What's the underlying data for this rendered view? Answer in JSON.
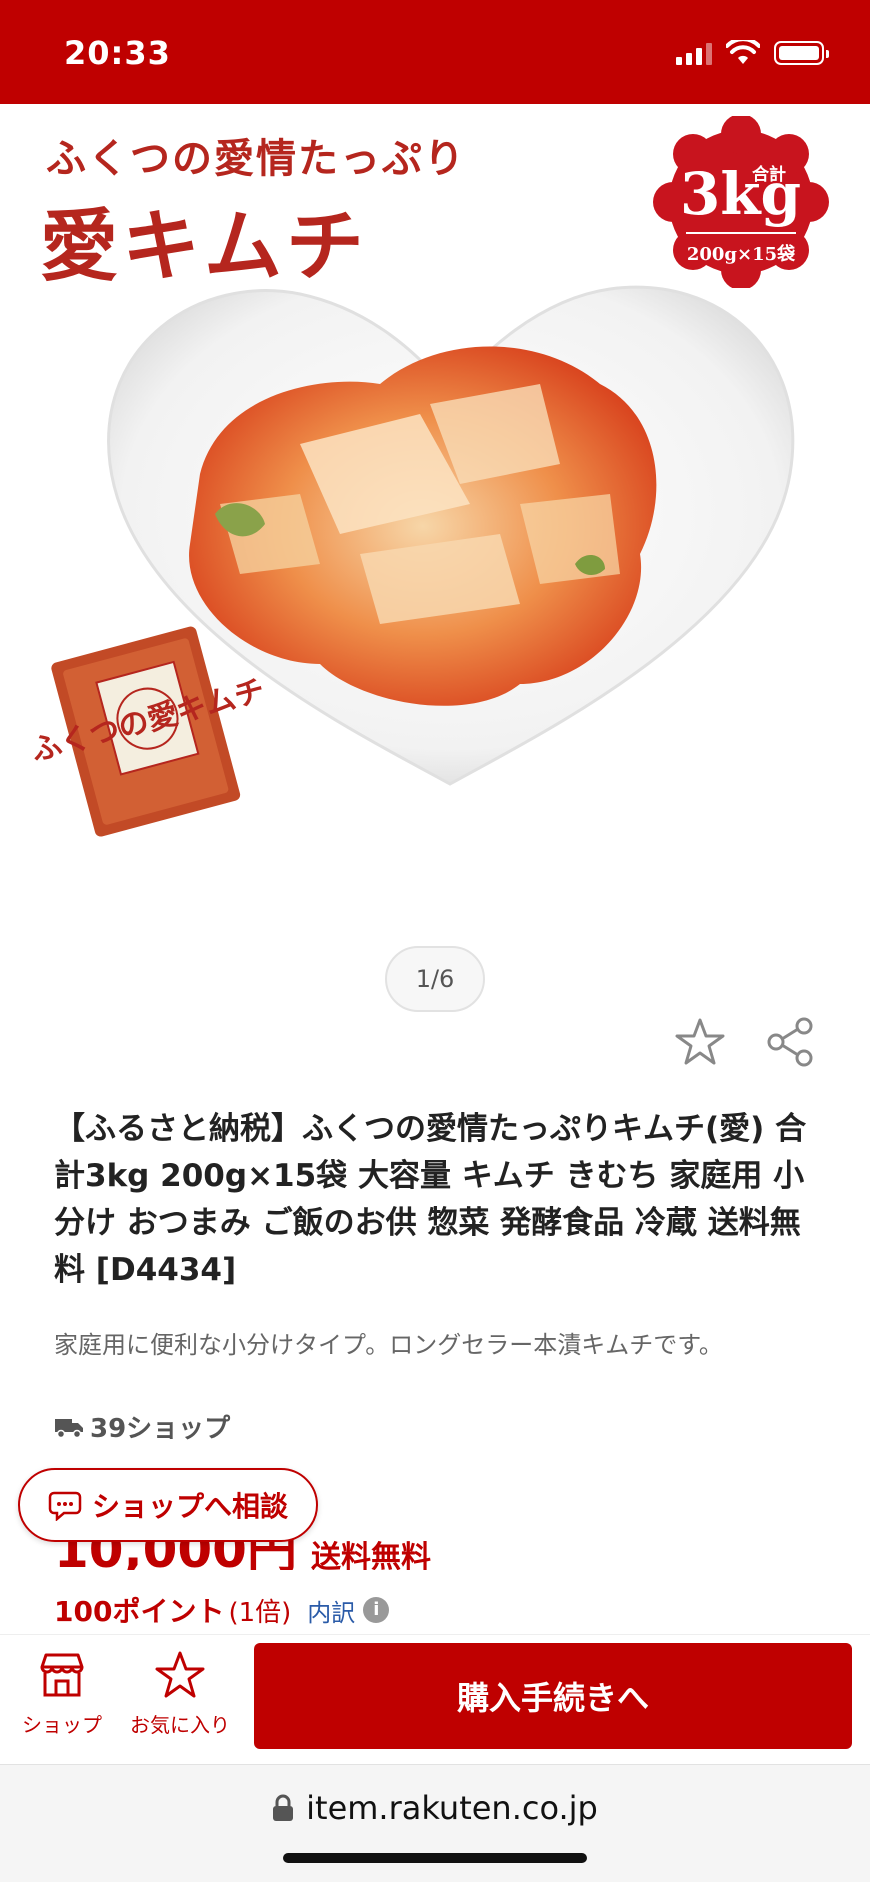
{
  "status_bar": {
    "time": "20:33"
  },
  "hero": {
    "tagline": "ふくつの愛情たっぷり",
    "product_name": "愛キムチ",
    "badge": {
      "label": "合計",
      "weight": "3kg",
      "pack": "200g×15袋"
    },
    "package_label": "ふくつの愛キムチ"
  },
  "gallery": {
    "indicator": "1/6"
  },
  "product": {
    "title": "【ふるさと納税】ふくつの愛情たっぷりキムチ(愛) 合計3kg 200g×15袋 大容量 キムチ きむち 家庭用 小分け おつまみ ご飯のお供 惣菜 発酵食品 冷蔵 送料無料 [D4434]",
    "description": "家庭用に便利な小分けタイプ。ロングセラー本漬キムチです。",
    "shop_count": "39ショップ",
    "price": "10,000円",
    "shipping": "送料無料",
    "points": "100ポイント",
    "points_rate": "(1倍)",
    "breakdown": "内訳"
  },
  "consult": {
    "label": "ショップへ相談"
  },
  "action_bar": {
    "shop_label": "ショップ",
    "favorite_label": "お気に入り",
    "buy_label": "購入手続きへ"
  },
  "browser": {
    "url": "item.rakuten.co.jp"
  },
  "colors": {
    "brand": "#bf0000",
    "link": "#2a5ba8"
  }
}
